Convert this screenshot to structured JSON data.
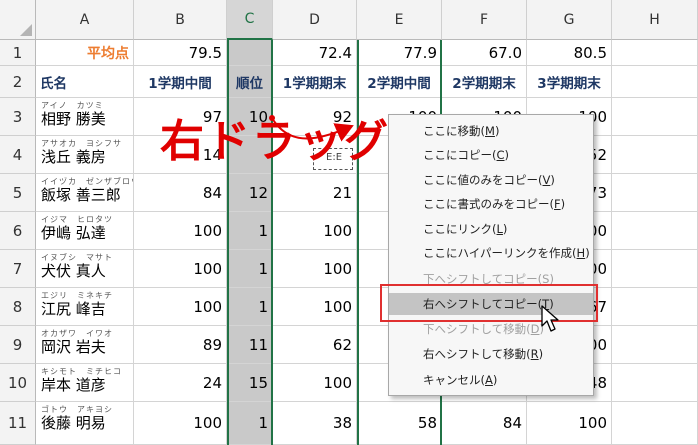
{
  "columns": [
    "A",
    "B",
    "C",
    "D",
    "E",
    "F",
    "G",
    "H"
  ],
  "rows": [
    "1",
    "2",
    "3",
    "4",
    "5",
    "6",
    "7",
    "8",
    "9",
    "10",
    "11"
  ],
  "row1": {
    "label": "平均点",
    "b": "79.5",
    "c": "",
    "d": "72.4",
    "e": "77.9",
    "f": "67.0",
    "g": "80.5"
  },
  "headers": {
    "a": "氏名",
    "b": "1学期中間",
    "c": "順位",
    "d": "1学期期末",
    "e": "2学期中間",
    "f": "2学期期末",
    "g": "3学期期末"
  },
  "students": [
    {
      "furigana": "アイノ　カツミ",
      "name": "相野 勝美",
      "b": "97",
      "c": "10",
      "d": "92",
      "e": "100",
      "f": "100",
      "g": "100"
    },
    {
      "furigana": "アサオカ　ヨシフサ",
      "name": "浅丘 義房",
      "b": "14",
      "c": "",
      "d": "",
      "e": "",
      "f": "",
      "g": "52"
    },
    {
      "furigana": "イイヅカ　ゼンザブロウ",
      "name": "飯塚 善三郎",
      "b": "84",
      "c": "12",
      "d": "21",
      "e": "",
      "f": "",
      "g": "73"
    },
    {
      "furigana": "イジマ　ヒロタツ",
      "name": "伊嶋 弘達",
      "b": "100",
      "c": "1",
      "d": "100",
      "e": "",
      "f": "",
      "g": "00"
    },
    {
      "furigana": "イヌブシ　マサト",
      "name": "犬伏 真人",
      "b": "100",
      "c": "1",
      "d": "100",
      "e": "",
      "f": "",
      "g": "00"
    },
    {
      "furigana": "エジリ　ミネキチ",
      "name": "江尻 峰吉",
      "b": "100",
      "c": "1",
      "d": "100",
      "e": "",
      "f": "",
      "g": "67"
    },
    {
      "furigana": "オカザワ　イワオ",
      "name": "岡沢 岩夫",
      "b": "89",
      "c": "11",
      "d": "62",
      "e": "",
      "f": "",
      "g": "00"
    },
    {
      "furigana": "キシモト　ミチヒコ",
      "name": "岸本 道彦",
      "b": "24",
      "c": "15",
      "d": "100",
      "e": "",
      "f": "",
      "g": "48"
    },
    {
      "furigana": "ゴトウ　アキヨシ",
      "name": "後藤 明易",
      "b": "100",
      "c": "1",
      "d": "38",
      "e": "58",
      "f": "84",
      "g": "100"
    }
  ],
  "partial_label": "E:E",
  "annotation": "右ドラッグ！",
  "context_menu": [
    {
      "text": "ここに移動",
      "key": "M",
      "disabled": false,
      "highlighted": false
    },
    {
      "text": "ここにコピー",
      "key": "C",
      "disabled": false,
      "highlighted": false
    },
    {
      "text": "ここに値のみをコピー",
      "key": "V",
      "disabled": false,
      "highlighted": false
    },
    {
      "text": "ここに書式のみをコピー",
      "key": "F",
      "disabled": false,
      "highlighted": false
    },
    {
      "text": "ここにリンク",
      "key": "L",
      "disabled": false,
      "highlighted": false
    },
    {
      "text": "ここにハイパーリンクを作成",
      "key": "H",
      "disabled": false,
      "highlighted": false
    },
    {
      "text": "下へシフトしてコピー",
      "key": "S",
      "disabled": true,
      "highlighted": false
    },
    {
      "text": "右へシフトしてコピー",
      "key": "T",
      "disabled": false,
      "highlighted": true
    },
    {
      "text": "下へシフトして移動",
      "key": "D",
      "disabled": true,
      "highlighted": false
    },
    {
      "text": "右へシフトして移動",
      "key": "R",
      "disabled": false,
      "highlighted": false
    },
    {
      "text": "キャンセル",
      "key": "A",
      "disabled": false,
      "highlighted": false
    }
  ],
  "colors": {
    "selection": "#217346",
    "annotation": "#e00000",
    "avg_label": "#ed7d31",
    "header_text": "#1f3864",
    "highlight_box": "#e03030"
  }
}
